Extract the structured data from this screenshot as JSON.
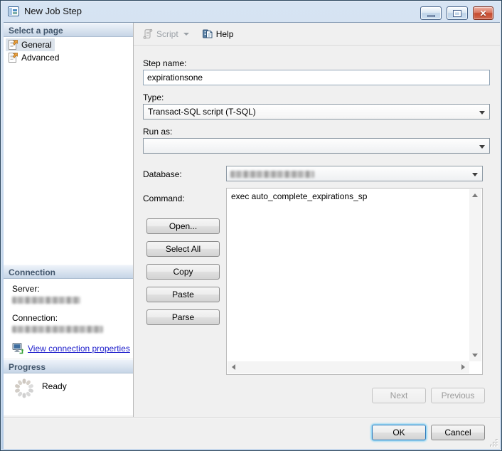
{
  "window": {
    "title": "New Job Step"
  },
  "sidebar": {
    "select_page": {
      "header": "Select a page",
      "items": [
        {
          "label": "General"
        },
        {
          "label": "Advanced"
        }
      ]
    },
    "connection": {
      "header": "Connection",
      "server_label": "Server:",
      "connection_label": "Connection:",
      "link_label": "View connection properties"
    },
    "progress": {
      "header": "Progress",
      "status": "Ready"
    }
  },
  "toolbar": {
    "script_label": "Script",
    "help_label": "Help"
  },
  "form": {
    "step_name_label": "Step name:",
    "step_name_value": "expirationsone",
    "type_label": "Type:",
    "type_value": "Transact-SQL script (T-SQL)",
    "run_as_label": "Run as:",
    "database_label": "Database:",
    "command_label": "Command:",
    "command_value": "exec auto_complete_expirations_sp",
    "open_button": "Open...",
    "select_all_button": "Select All",
    "copy_button": "Copy",
    "paste_button": "Paste",
    "parse_button": "Parse"
  },
  "footer": {
    "next_button": "Next",
    "previous_button": "Previous",
    "ok_button": "OK",
    "cancel_button": "Cancel"
  },
  "colors": {
    "titlebar": "#c5d8ec",
    "panel_header_text": "#42566c",
    "link": "#2222cc",
    "close_button": "#c54a2e",
    "ok_focus_glow": "#83d2f4"
  }
}
